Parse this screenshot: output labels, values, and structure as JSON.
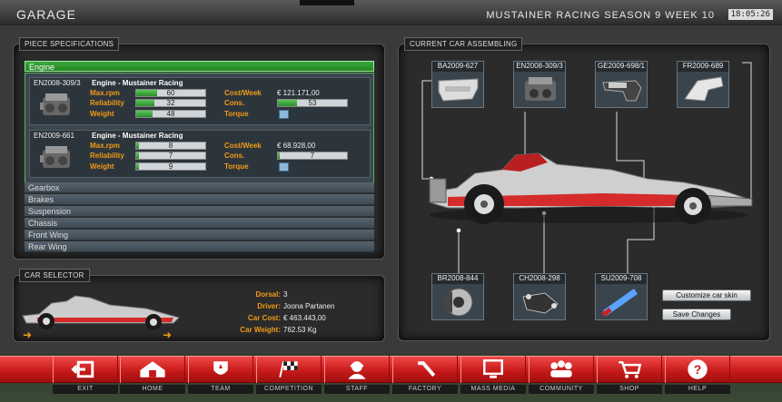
{
  "header": {
    "title": "GARAGE",
    "season": "MUSTAINER RACING SEASON 9 WEEK 10",
    "clock": "18:05:26"
  },
  "spec_panel": {
    "title": "PIECE SPECIFICATIONS",
    "selected_category": "Engine",
    "pieces": [
      {
        "code": "EN2008-309/3",
        "name": "Engine - Mustainer Racing",
        "max_rpm_label": "Max.rpm",
        "max_rpm": "60",
        "max_rpm_level": 0.3,
        "reliability_label": "Reliability",
        "reliability": "32",
        "reliability_level": 0.26,
        "weight_label": "Weight",
        "weight": "48",
        "weight_level": 0.24,
        "cost_label": "Cost/Week",
        "cost": "€ 121.171,00",
        "cons_label": "Cons.",
        "cons": "53",
        "cons_level": 0.27,
        "torque_label": "Torque"
      },
      {
        "code": "EN2009-661",
        "name": "Engine - Mustainer Racing",
        "max_rpm_label": "Max.rpm",
        "max_rpm": "8",
        "max_rpm_level": 0.04,
        "reliability_label": "Reliability",
        "reliability": "7",
        "reliability_level": 0.04,
        "weight_label": "Weight",
        "weight": "9",
        "weight_level": 0.04,
        "cost_label": "Cost/Week",
        "cost": "€ 68.928,00",
        "cons_label": "Cons.",
        "cons": "7",
        "cons_level": 0.03,
        "torque_label": "Torque"
      }
    ],
    "categories": [
      "Gearbox",
      "Brakes",
      "Suspension",
      "Chassis",
      "Front Wing",
      "Rear Wing"
    ]
  },
  "assemble_panel": {
    "title": "CURRENT CAR ASSEMBLING",
    "parts_top": [
      "BA2009-627",
      "EN2008-309/3",
      "GE2009-698/1",
      "FR2009-689"
    ],
    "parts_bottom": [
      "BR2008-844",
      "CH2008-298",
      "SU2009-708"
    ],
    "customize_label": "Customize car skin",
    "save_label": "Save Changes"
  },
  "selector_panel": {
    "title": "CAR SELECTOR",
    "dorsal_label": "Dorsal:",
    "dorsal": "3",
    "driver_label": "Driver:",
    "driver": "Joona Partanen",
    "cost_label": "Car Cost:",
    "cost": "€ 463.443,00",
    "weight_label": "Car Weight:",
    "weight": "762.53 Kg"
  },
  "nav": [
    {
      "label": "EXIT",
      "icon": "exit-icon"
    },
    {
      "label": "HOME",
      "icon": "home-icon"
    },
    {
      "label": "TEAM",
      "icon": "team-icon"
    },
    {
      "label": "COMPETITION",
      "icon": "flag-icon"
    },
    {
      "label": "STAFF",
      "icon": "staff-icon"
    },
    {
      "label": "FACTORY",
      "icon": "wrench-icon"
    },
    {
      "label": "MASS MEDIA",
      "icon": "monitor-icon"
    },
    {
      "label": "COMMUNITY",
      "icon": "community-icon"
    },
    {
      "label": "SHOP",
      "icon": "cart-icon"
    },
    {
      "label": "HELP",
      "icon": "help-icon"
    }
  ],
  "colors": {
    "accent_orange": "#f29b16",
    "selected_green": "#2f9a2f",
    "nav_red": "#d22020"
  }
}
